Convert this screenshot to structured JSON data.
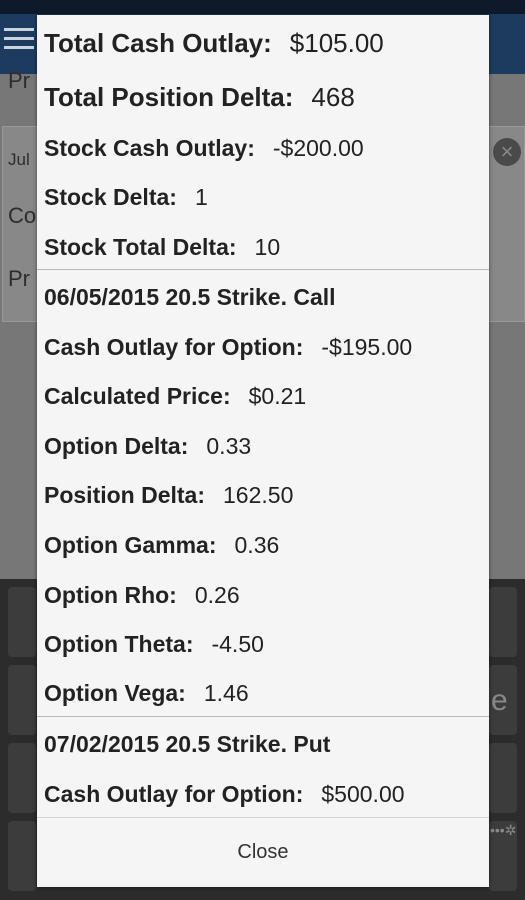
{
  "background": {
    "row1_text": "Pr",
    "row2_text": "Jul",
    "row3_text": "Co",
    "row4_text": "Pr",
    "keyboard_key_e": "e",
    "keyboard_dots": "•••✲"
  },
  "dialog": {
    "summary": [
      {
        "label": "Total Cash Outlay:",
        "value": "$105.00"
      },
      {
        "label": "Total Position Delta:",
        "value": "468"
      },
      {
        "label": "Stock Cash Outlay:",
        "value": "-$200.00"
      },
      {
        "label": "Stock Delta:",
        "value": "1"
      },
      {
        "label": "Stock Total Delta:",
        "value": "10"
      }
    ],
    "option1": {
      "heading": "06/05/2015 20.5 Strike. Call",
      "rows": [
        {
          "label": "Cash Outlay for Option:",
          "value": "-$195.00"
        },
        {
          "label": "Calculated Price:",
          "value": "$0.21"
        },
        {
          "label": "Option Delta:",
          "value": "0.33"
        },
        {
          "label": "Position Delta:",
          "value": "162.50"
        },
        {
          "label": "Option Gamma:",
          "value": "0.36"
        },
        {
          "label": "Option Rho:",
          "value": "0.26"
        },
        {
          "label": "Option Theta:",
          "value": "-4.50"
        },
        {
          "label": "Option Vega:",
          "value": "1.46"
        }
      ]
    },
    "option2": {
      "heading": "07/02/2015 20.5 Strike. Put",
      "rows": [
        {
          "label": "Cash Outlay for Option:",
          "value": "$500.00"
        }
      ]
    },
    "close_label": "Close"
  }
}
